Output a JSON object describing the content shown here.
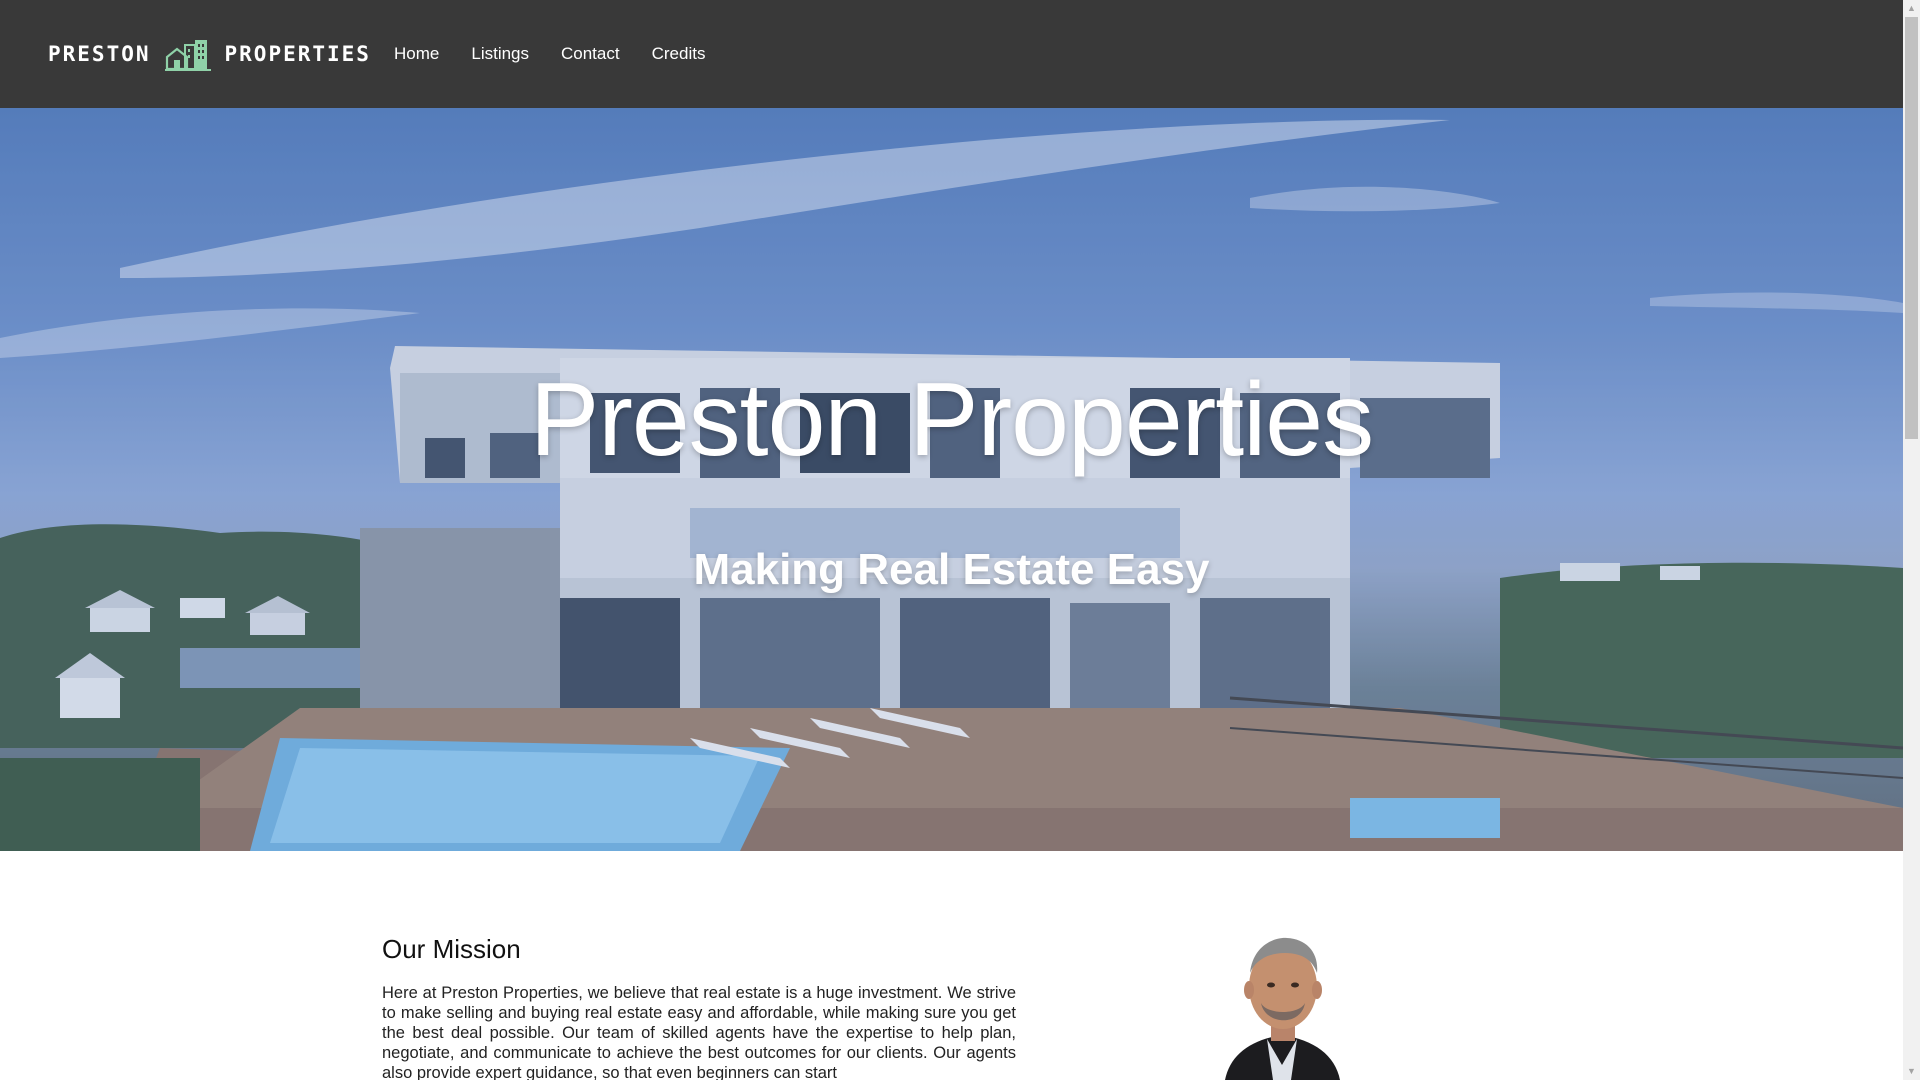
{
  "brand": {
    "left_word": "PRESTON",
    "right_word": "PROPERTIES",
    "logo_icon": "house-buildings-icon",
    "logo_color": "#8fd1a8"
  },
  "nav": {
    "items": [
      {
        "label": "Home"
      },
      {
        "label": "Listings"
      },
      {
        "label": "Contact"
      },
      {
        "label": "Credits"
      }
    ]
  },
  "hero": {
    "title": "Preston Properties",
    "subtitle": "Making Real Estate Easy",
    "background": "modern-beach-house-photo"
  },
  "mission": {
    "heading": "Our Mission",
    "text": "Here at Preston Properties, we believe that real estate is a huge investment. We strive to make selling and buying real estate easy and affordable, while making sure you get the best deal possible. Our team of skilled agents have the expertise to help plan, negotiate, and communicate to achieve the best outcomes for our clients. Our agents also provide expert guidance, so that even beginners can start"
  },
  "colors": {
    "navbar": "#393939",
    "nav_text": "#ffffff",
    "hero_text": "#ffffff",
    "body_text": "#222222"
  }
}
